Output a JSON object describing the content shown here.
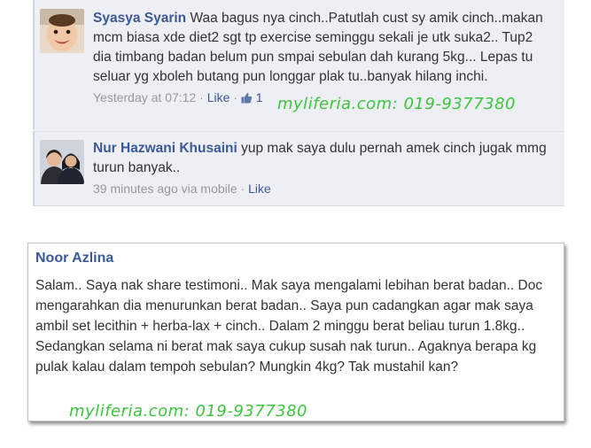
{
  "comments": [
    {
      "author": "Syasya Syarin",
      "text": "Waa bagus nya cinch..Patutlah cust sy amik cinch..makan mcm biasa xde diet2 sgt tp exercise seminggu sekali je utk suka2.. Tup2 dia timbang badan belum pun smpai sebulan dah kurang 5kg... Lepas tu seluar yg xboleh butang pun longgar plak tu..banyak hilang inchi.",
      "time": "Yesterday at 07:12",
      "sep": " · ",
      "like_label": "Like",
      "like_count": "1"
    },
    {
      "author": "Nur Hazwani Khusaini",
      "text": "yup mak saya dulu pernah amek cinch jugak mmg turun banyak..",
      "time": "39 minutes ago via mobile",
      "sep": " · ",
      "like_label": "Like"
    }
  ],
  "testimonial": {
    "author": "Noor Azlina",
    "text": "Salam.. Saya nak share testimoni.. Mak saya mengalami lebihan berat badan.. Doc mengarahkan dia menurunkan berat badan.. Saya pun cadangkan agar mak saya ambil set lecithin + herba-lax + cinch.. Dalam 2 minggu berat beliau turun 1.8kg.. Sedangkan selama ni berat mak saya cukup susah nak turun.. Agaknya berapa kg pulak kalau dalam tempoh sebulan? Mungkin 4kg? Tak mustahil kan?"
  },
  "watermark": "myliferia.com: 019-9377380",
  "colors": {
    "link": "#3b5998",
    "watermark": "#3cc53c",
    "panel_bg": "#edeff4"
  }
}
